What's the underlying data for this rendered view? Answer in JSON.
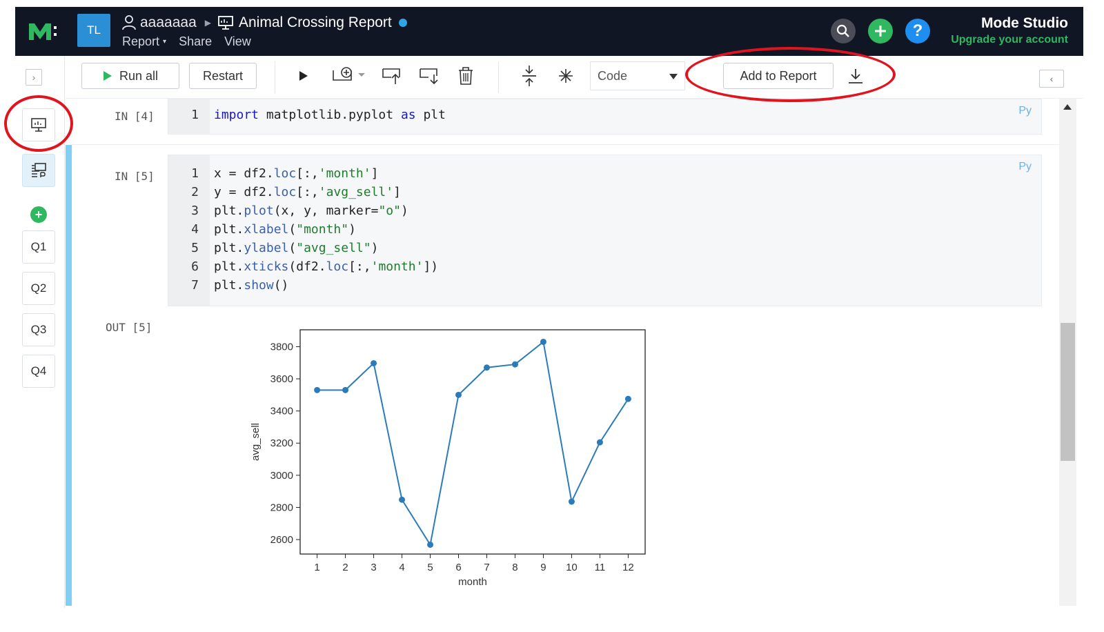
{
  "app": {
    "avatar_initials": "TL",
    "user": "aaaaaaa",
    "report_title": "Animal Crossing Report",
    "menu": [
      "Report",
      "Share",
      "View"
    ],
    "studio_name": "Mode Studio",
    "upgrade_label": "Upgrade your account"
  },
  "toolbar": {
    "run_all": "Run all",
    "restart": "Restart",
    "cell_type": "Code",
    "add_to_report": "Add to Report"
  },
  "rail": {
    "queries": [
      "Q1",
      "Q2",
      "Q3",
      "Q4"
    ]
  },
  "cells": [
    {
      "label": "IN [4]",
      "lang": "Py",
      "lines": [
        [
          [
            "1",
            ""
          ],
          [
            "import",
            "kw"
          ],
          [
            " matplotlib.pyplot ",
            ""
          ],
          [
            "as",
            "kw"
          ],
          [
            " plt",
            ""
          ]
        ]
      ]
    },
    {
      "label": "IN [5]",
      "lang": "Py",
      "lines": [
        [
          [
            "x = df2.",
            ""
          ],
          [
            "loc",
            "fn"
          ],
          [
            "[:,",
            ""
          ],
          [
            "'month'",
            "str"
          ],
          [
            "]",
            ""
          ]
        ],
        [
          [
            "y = df2.",
            ""
          ],
          [
            "loc",
            "fn"
          ],
          [
            "[:,",
            ""
          ],
          [
            "'avg_sell'",
            "str"
          ],
          [
            "]",
            ""
          ]
        ],
        [
          [
            "plt.",
            ""
          ],
          [
            "plot",
            "fn"
          ],
          [
            "(x, y, marker=",
            ""
          ],
          [
            "\"o\"",
            "str"
          ],
          [
            ")",
            ""
          ]
        ],
        [
          [
            "plt.",
            ""
          ],
          [
            "xlabel",
            "fn"
          ],
          [
            "(",
            ""
          ],
          [
            "\"month\"",
            "str"
          ],
          [
            ")",
            ""
          ]
        ],
        [
          [
            "plt.",
            ""
          ],
          [
            "ylabel",
            "fn"
          ],
          [
            "(",
            ""
          ],
          [
            "\"avg_sell\"",
            "str"
          ],
          [
            ")",
            ""
          ]
        ],
        [
          [
            "plt.",
            ""
          ],
          [
            "xticks",
            "fn"
          ],
          [
            "(df2.",
            ""
          ],
          [
            "loc",
            "fn"
          ],
          [
            "[:,",
            ""
          ],
          [
            "'month'",
            "str"
          ],
          [
            "])",
            ""
          ]
        ],
        [
          [
            "plt.",
            ""
          ],
          [
            "show",
            "fn"
          ],
          [
            "()",
            ""
          ]
        ]
      ]
    }
  ],
  "output_label": "OUT [5]",
  "chart_data": {
    "type": "line",
    "x": [
      1,
      2,
      3,
      4,
      5,
      6,
      7,
      8,
      9,
      10,
      11,
      12
    ],
    "series": [
      {
        "values": [
          3530,
          3530,
          3697,
          2848,
          2568,
          3500,
          3670,
          3690,
          3830,
          2836,
          3205,
          3475
        ]
      }
    ],
    "xlabel": "month",
    "ylabel": "avg_sell",
    "xlim": [
      0.4,
      12.6
    ],
    "ylim": [
      2510,
      3905
    ],
    "yticks": [
      2600,
      2800,
      3000,
      3200,
      3400,
      3600,
      3800
    ],
    "xticks": [
      1,
      2,
      3,
      4,
      5,
      6,
      7,
      8,
      9,
      10,
      11,
      12
    ],
    "color": "#2b7bba",
    "grid": false
  },
  "colors": {
    "topbar": "#111625",
    "accent_blue": "#2a8fd4",
    "green": "#2fb860",
    "highlight_red": "#e0141e"
  }
}
